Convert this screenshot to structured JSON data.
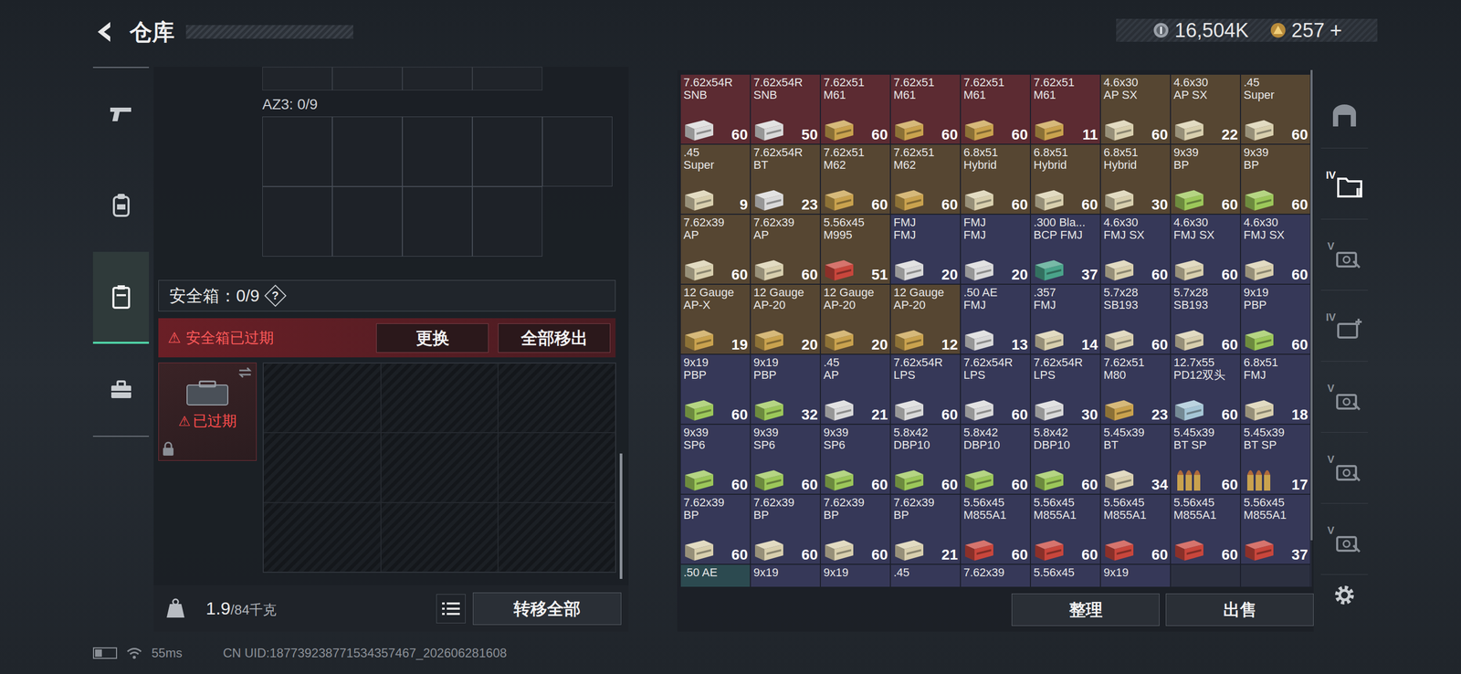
{
  "header": {
    "title": "仓库",
    "currencies": [
      {
        "amount": "16,504K",
        "kind": "silver"
      },
      {
        "amount": "257",
        "add": "+",
        "kind": "gold"
      }
    ]
  },
  "nav": [
    {
      "kind": "gun",
      "selected": false
    },
    {
      "kind": "armor",
      "selected": false
    },
    {
      "kind": "case",
      "selected": true
    },
    {
      "kind": "toolbox",
      "selected": false
    }
  ],
  "left_panel": {
    "container_label": "AZ3: 0/9",
    "safe_box": {
      "label": "安全箱：0/9",
      "help": "?"
    },
    "alert": {
      "icon": "⚠",
      "text": "安全箱已过期"
    },
    "buttons": [
      "更换",
      "全部移出"
    ],
    "case_item": {
      "icon": "⚠",
      "status": "已过期",
      "locked": true,
      "expired": true
    },
    "weight": {
      "value": "1.9",
      "capacity": "/84千克"
    },
    "transfer_button": "转移全部"
  },
  "stash": {
    "items": [
      {
        "lines": [
          "7.62x54R",
          "SNB"
        ],
        "count": "60",
        "color": "#5c2b32",
        "box_color": "#d9d9d9",
        "kind": "box"
      },
      {
        "lines": [
          "7.62x54R",
          "SNB"
        ],
        "count": "50",
        "color": "#5c2b32",
        "box_color": "#d9d9d9",
        "kind": "box"
      },
      {
        "lines": [
          "7.62x51",
          "M61"
        ],
        "count": "60",
        "color": "#5c2b32",
        "box_color": "#c9a24e",
        "kind": "box"
      },
      {
        "lines": [
          "7.62x51",
          "M61"
        ],
        "count": "60",
        "color": "#5c2b32",
        "box_color": "#c9a24e",
        "kind": "box"
      },
      {
        "lines": [
          "7.62x51",
          "M61"
        ],
        "count": "60",
        "color": "#5c2b32",
        "box_color": "#c9a24e",
        "kind": "box"
      },
      {
        "lines": [
          "7.62x51",
          "M61"
        ],
        "count": "11",
        "color": "#5c2b32",
        "box_color": "#c9a24e",
        "kind": "box"
      },
      {
        "lines": [
          "4.6x30",
          "AP SX"
        ],
        "count": "60",
        "color": "#564632",
        "box_color": "#d8cfae",
        "kind": "box"
      },
      {
        "lines": [
          "4.6x30",
          "AP SX"
        ],
        "count": "22",
        "color": "#564632",
        "box_color": "#d8cfae",
        "kind": "box"
      },
      {
        "lines": [
          ".45",
          "Super"
        ],
        "count": "60",
        "color": "#564632",
        "box_color": "#d8cfae",
        "kind": "box"
      },
      {
        "lines": [
          ".45",
          "Super"
        ],
        "count": "9",
        "color": "#564632",
        "box_color": "#d8cfae",
        "kind": "box"
      },
      {
        "lines": [
          "7.62x54R",
          "BT"
        ],
        "count": "23",
        "color": "#564632",
        "box_color": "#d9d9d9",
        "kind": "box"
      },
      {
        "lines": [
          "7.62x51",
          "M62"
        ],
        "count": "60",
        "color": "#564632",
        "box_color": "#c9a24e",
        "kind": "box"
      },
      {
        "lines": [
          "7.62x51",
          "M62"
        ],
        "count": "60",
        "color": "#564632",
        "box_color": "#c9a24e",
        "kind": "box"
      },
      {
        "lines": [
          "6.8x51",
          "Hybrid"
        ],
        "count": "60",
        "color": "#564632",
        "box_color": "#d8cfae",
        "kind": "box"
      },
      {
        "lines": [
          "6.8x51",
          "Hybrid"
        ],
        "count": "60",
        "color": "#564632",
        "box_color": "#d8cfae",
        "kind": "box"
      },
      {
        "lines": [
          "6.8x51",
          "Hybrid"
        ],
        "count": "30",
        "color": "#564632",
        "box_color": "#d8cfae",
        "kind": "box"
      },
      {
        "lines": [
          "9x39",
          "BP"
        ],
        "count": "60",
        "color": "#564632",
        "box_color": "#9cc75a",
        "kind": "box"
      },
      {
        "lines": [
          "9x39",
          "BP"
        ],
        "count": "60",
        "color": "#564632",
        "box_color": "#9cc75a",
        "kind": "box"
      },
      {
        "lines": [
          "7.62x39",
          "AP"
        ],
        "count": "60",
        "color": "#564632",
        "box_color": "#d8cfae",
        "kind": "box"
      },
      {
        "lines": [
          "7.62x39",
          "AP"
        ],
        "count": "60",
        "color": "#564632",
        "box_color": "#d8cfae",
        "kind": "box"
      },
      {
        "lines": [
          "5.56x45",
          "M995"
        ],
        "count": "51",
        "color": "#564632",
        "box_color": "#c8463c",
        "kind": "box"
      },
      {
        "lines": [
          "FMJ",
          "FMJ"
        ],
        "count": "20",
        "color": "#363858",
        "box_color": "#d9d9d9",
        "kind": "box"
      },
      {
        "lines": [
          "FMJ",
          "FMJ"
        ],
        "count": "20",
        "color": "#363858",
        "box_color": "#d9d9d9",
        "kind": "box"
      },
      {
        "lines": [
          ".300 Bla...",
          "BCP FMJ"
        ],
        "count": "37",
        "color": "#363858",
        "box_color": "#4aa38a",
        "kind": "box"
      },
      {
        "lines": [
          "4.6x30",
          "FMJ SX"
        ],
        "count": "60",
        "color": "#363858",
        "box_color": "#d8cfae",
        "kind": "box"
      },
      {
        "lines": [
          "4.6x30",
          "FMJ SX"
        ],
        "count": "60",
        "color": "#363858",
        "box_color": "#d8cfae",
        "kind": "box"
      },
      {
        "lines": [
          "4.6x30",
          "FMJ SX"
        ],
        "count": "60",
        "color": "#363858",
        "box_color": "#d8cfae",
        "kind": "box"
      },
      {
        "lines": [
          "12 Gauge",
          "AP-X"
        ],
        "count": "19",
        "color": "#564632",
        "box_color": "#c9a24e",
        "kind": "box"
      },
      {
        "lines": [
          "12 Gauge",
          "AP-20"
        ],
        "count": "20",
        "color": "#564632",
        "box_color": "#c9a24e",
        "kind": "box"
      },
      {
        "lines": [
          "12 Gauge",
          "AP-20"
        ],
        "count": "20",
        "color": "#564632",
        "box_color": "#c9a24e",
        "kind": "box"
      },
      {
        "lines": [
          "12 Gauge",
          "AP-20"
        ],
        "count": "12",
        "color": "#564632",
        "box_color": "#c9a24e",
        "kind": "box"
      },
      {
        "lines": [
          ".50 AE",
          "FMJ"
        ],
        "count": "13",
        "color": "#363858",
        "box_color": "#d9d9d9",
        "kind": "box"
      },
      {
        "lines": [
          ".357",
          "FMJ"
        ],
        "count": "14",
        "color": "#363858",
        "box_color": "#d8cfae",
        "kind": "box"
      },
      {
        "lines": [
          "5.7x28",
          "SB193"
        ],
        "count": "60",
        "color": "#363858",
        "box_color": "#d8cfae",
        "kind": "box"
      },
      {
        "lines": [
          "5.7x28",
          "SB193"
        ],
        "count": "60",
        "color": "#363858",
        "box_color": "#d8cfae",
        "kind": "box"
      },
      {
        "lines": [
          "9x19",
          "PBP"
        ],
        "count": "60",
        "color": "#363858",
        "box_color": "#9cc75a",
        "kind": "box"
      },
      {
        "lines": [
          "9x19",
          "PBP"
        ],
        "count": "60",
        "color": "#363858",
        "box_color": "#9cc75a",
        "kind": "box"
      },
      {
        "lines": [
          "9x19",
          "PBP"
        ],
        "count": "32",
        "color": "#363858",
        "box_color": "#9cc75a",
        "kind": "box"
      },
      {
        "lines": [
          ".45",
          "AP"
        ],
        "count": "21",
        "color": "#363858",
        "box_color": "#d9d9d9",
        "kind": "box"
      },
      {
        "lines": [
          "7.62x54R",
          "LPS"
        ],
        "count": "60",
        "color": "#363858",
        "box_color": "#d9d9d9",
        "kind": "box"
      },
      {
        "lines": [
          "7.62x54R",
          "LPS"
        ],
        "count": "60",
        "color": "#363858",
        "box_color": "#d9d9d9",
        "kind": "box"
      },
      {
        "lines": [
          "7.62x54R",
          "LPS"
        ],
        "count": "30",
        "color": "#363858",
        "box_color": "#d9d9d9",
        "kind": "box"
      },
      {
        "lines": [
          "7.62x51",
          "M80"
        ],
        "count": "23",
        "color": "#363858",
        "box_color": "#c9a24e",
        "kind": "box"
      },
      {
        "lines": [
          "12.7x55",
          "PD12双头"
        ],
        "count": "60",
        "color": "#363858",
        "box_color": "#a6c6d6",
        "kind": "box"
      },
      {
        "lines": [
          "6.8x51",
          "FMJ"
        ],
        "count": "18",
        "color": "#363858",
        "box_color": "#d8cfae",
        "kind": "box"
      },
      {
        "lines": [
          "9x39",
          "SP6"
        ],
        "count": "60",
        "color": "#363858",
        "box_color": "#9cc75a",
        "kind": "box"
      },
      {
        "lines": [
          "9x39",
          "SP6"
        ],
        "count": "60",
        "color": "#363858",
        "box_color": "#9cc75a",
        "kind": "box"
      },
      {
        "lines": [
          "9x39",
          "SP6"
        ],
        "count": "60",
        "color": "#363858",
        "box_color": "#9cc75a",
        "kind": "box"
      },
      {
        "lines": [
          "5.8x42",
          "DBP10"
        ],
        "count": "60",
        "color": "#363858",
        "box_color": "#9cc75a",
        "kind": "box"
      },
      {
        "lines": [
          "5.8x42",
          "DBP10"
        ],
        "count": "60",
        "color": "#363858",
        "box_color": "#9cc75a",
        "kind": "box"
      },
      {
        "lines": [
          "5.8x42",
          "DBP10"
        ],
        "count": "60",
        "color": "#363858",
        "box_color": "#9cc75a",
        "kind": "box"
      },
      {
        "lines": [
          "5.45x39",
          "BT"
        ],
        "count": "34",
        "color": "#363858",
        "box_color": "#d8cfae",
        "kind": "box"
      },
      {
        "lines": [
          "5.45x39",
          "BT SP"
        ],
        "count": "60",
        "color": "#363858",
        "box_color": "#c9a24e",
        "kind": "rounds"
      },
      {
        "lines": [
          "5.45x39",
          "BT SP"
        ],
        "count": "17",
        "color": "#363858",
        "box_color": "#c9a24e",
        "kind": "rounds"
      },
      {
        "lines": [
          "7.62x39",
          "BP"
        ],
        "count": "60",
        "color": "#363858",
        "box_color": "#d8cfae",
        "kind": "box"
      },
      {
        "lines": [
          "7.62x39",
          "BP"
        ],
        "count": "60",
        "color": "#363858",
        "box_color": "#d8cfae",
        "kind": "box"
      },
      {
        "lines": [
          "7.62x39",
          "BP"
        ],
        "count": "60",
        "color": "#363858",
        "box_color": "#d8cfae",
        "kind": "box"
      },
      {
        "lines": [
          "7.62x39",
          "BP"
        ],
        "count": "21",
        "color": "#363858",
        "box_color": "#d8cfae",
        "kind": "box"
      },
      {
        "lines": [
          "5.56x45",
          "M855A1"
        ],
        "count": "60",
        "color": "#363858",
        "box_color": "#c8463c",
        "kind": "box"
      },
      {
        "lines": [
          "5.56x45",
          "M855A1"
        ],
        "count": "60",
        "color": "#363858",
        "box_color": "#c8463c",
        "kind": "box"
      },
      {
        "lines": [
          "5.56x45",
          "M855A1"
        ],
        "count": "60",
        "color": "#363858",
        "box_color": "#c8463c",
        "kind": "box"
      },
      {
        "lines": [
          "5.56x45",
          "M855A1"
        ],
        "count": "60",
        "color": "#363858",
        "box_color": "#c8463c",
        "kind": "box"
      },
      {
        "lines": [
          "5.56x45",
          "M855A1"
        ],
        "count": "37",
        "color": "#363858",
        "box_color": "#c8463c",
        "kind": "box"
      },
      {
        "lines": [
          ".50 AE"
        ],
        "color": "#2c4a50",
        "box_color": "#d9d9d9",
        "kind": "box"
      },
      {
        "lines": [
          "9x19"
        ],
        "color": "#363858",
        "box_color": "#9cc75a",
        "kind": "box"
      },
      {
        "lines": [
          "9x19"
        ],
        "color": "#363858",
        "box_color": "#9cc75a",
        "kind": "box"
      },
      {
        "lines": [
          ".45"
        ],
        "color": "#363858",
        "box_color": "#d9d9d9",
        "kind": "box"
      },
      {
        "lines": [
          "7.62x39"
        ],
        "color": "#363858",
        "box_color": "#d8cfae",
        "kind": "box"
      },
      {
        "lines": [
          "5.56x45"
        ],
        "color": "#363858",
        "box_color": "#c8463c",
        "kind": "box"
      },
      {
        "lines": [
          "9x19"
        ],
        "color": "#363858",
        "box_color": "#9cc75a",
        "kind": "box"
      }
    ]
  },
  "actions": [
    "整理",
    "出售"
  ],
  "side_tabs": [
    {
      "badge": "",
      "kind": "arch",
      "selected": false
    },
    {
      "badge": "IV",
      "kind": "folder",
      "selected": true
    },
    {
      "badge": "V",
      "kind": "case",
      "selected": false
    },
    {
      "badge": "IV",
      "kind": "case-plus",
      "selected": false
    },
    {
      "badge": "V",
      "kind": "case",
      "selected": false
    },
    {
      "badge": "V",
      "kind": "case",
      "selected": false
    },
    {
      "badge": "V",
      "kind": "case",
      "selected": false
    }
  ],
  "status_bar": {
    "battery_level": 0.35,
    "ping": "55ms",
    "uid": "CN UID:187739238771534357467_202606281608"
  }
}
